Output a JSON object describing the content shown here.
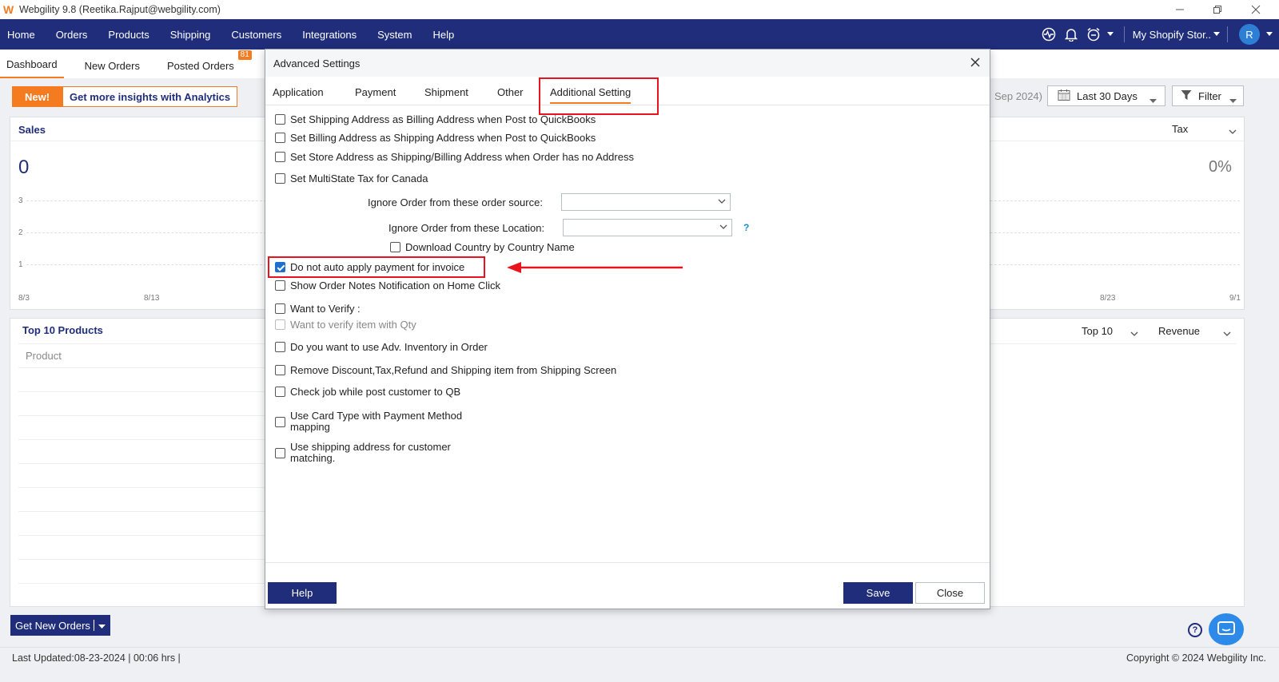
{
  "window": {
    "logo": "W",
    "title": "Webgility 9.8 (Reetika.Rajput@webgility.com)"
  },
  "nav": {
    "items": [
      "Home",
      "Orders",
      "Products",
      "Shipping",
      "Customers",
      "Integrations",
      "System",
      "Help"
    ],
    "store": "My Shopify Stor..",
    "avatar_initial": "R"
  },
  "subtabs": {
    "dashboard": "Dashboard",
    "new_orders": "New Orders",
    "posted_orders": "Posted Orders",
    "posted_badge": "81"
  },
  "dashboard": {
    "promo_new": "New!",
    "promo_text": "Get more insights with Analytics",
    "date_partial": "Sep 2024)",
    "date_range": "Last 30 Days",
    "filter": "Filter",
    "sales_title": "Sales",
    "sales_value": "0",
    "tax_label": "Tax",
    "tax_value": "0%",
    "y_ticks": [
      "3",
      "2",
      "1"
    ],
    "x_ticks_left": [
      "8/3",
      "8/13"
    ],
    "x_ticks_right": [
      "8/23",
      "9/1"
    ],
    "top10_title": "Top 10 Products",
    "product_col": "Product",
    "top10_select": "Top 10",
    "revenue_select": "Revenue",
    "get_new_orders": "Get New Orders",
    "last_updated": "Last Updated:08-23-2024 | 00:06 hrs |",
    "copyright": "Copyright © 2024 Webgility Inc.",
    "help_glyph": "?"
  },
  "modal": {
    "title": "Advanced Settings",
    "tabs": [
      "Application",
      "Payment",
      "Shipment",
      "Other",
      "Additional Setting"
    ],
    "options": {
      "ship_as_bill": "Set Shipping Address as Billing Address when Post to QuickBooks",
      "bill_as_ship": "Set Billing Address as Shipping Address when Post to QuickBooks",
      "store_addr": "Set Store Address as Shipping/Billing Address when Order has no Address",
      "multistate": "Set MultiState Tax for Canada",
      "download_country": "Download Country by Country Name",
      "no_auto_apply": "Do not auto apply payment for invoice",
      "order_notes": "Show Order Notes Notification on Home Click",
      "want_verify": "Want to Verify :",
      "verify_qty": "Want to verify item with Qty",
      "adv_inventory": "Do you want to use Adv. Inventory in Order",
      "remove_discount": "Remove Discount,Tax,Refund and Shipping item from Shipping Screen",
      "check_job": "Check job while post customer to QB",
      "card_type_1": "Use Card Type with Payment Method",
      "card_type_2": "mapping",
      "ship_addr_1": "Use shipping address for customer",
      "ship_addr_2": "matching."
    },
    "ignore_source_label": "Ignore Order from these order source:",
    "ignore_location_label": "Ignore Order from these  Location:",
    "qmark": "?",
    "help_btn": "Help",
    "save_btn": "Save",
    "close_btn": "Close"
  },
  "colors": {
    "nav": "#1f2d7b",
    "accent": "#f47b20",
    "highlight": "#e8131c",
    "check": "#1f6fd0"
  }
}
